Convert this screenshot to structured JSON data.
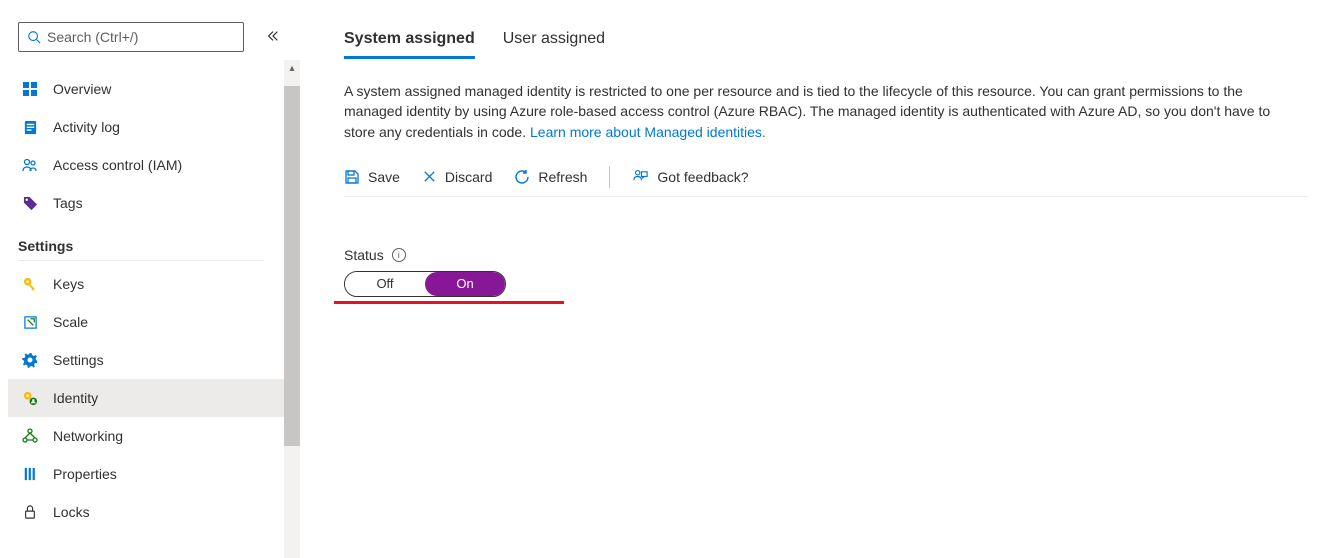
{
  "search": {
    "placeholder": "Search (Ctrl+/)"
  },
  "sidebar": {
    "primary": [
      {
        "label": "Overview"
      },
      {
        "label": "Activity log"
      },
      {
        "label": "Access control (IAM)"
      },
      {
        "label": "Tags"
      }
    ],
    "settings_heading": "Settings",
    "settings": [
      {
        "label": "Keys"
      },
      {
        "label": "Scale"
      },
      {
        "label": "Settings"
      },
      {
        "label": "Identity"
      },
      {
        "label": "Networking"
      },
      {
        "label": "Properties"
      },
      {
        "label": "Locks"
      }
    ]
  },
  "tabs": {
    "system": "System assigned",
    "user": "User assigned"
  },
  "description": {
    "text": "A system assigned managed identity is restricted to one per resource and is tied to the lifecycle of this resource. You can grant permissions to the managed identity by using Azure role-based access control (Azure RBAC). The managed identity is authenticated with Azure AD, so you don't have to store any credentials in code. ",
    "link_text": "Learn more about Managed identities."
  },
  "commands": {
    "save": "Save",
    "discard": "Discard",
    "refresh": "Refresh",
    "feedback": "Got feedback?"
  },
  "status": {
    "label": "Status",
    "off": "Off",
    "on": "On"
  }
}
